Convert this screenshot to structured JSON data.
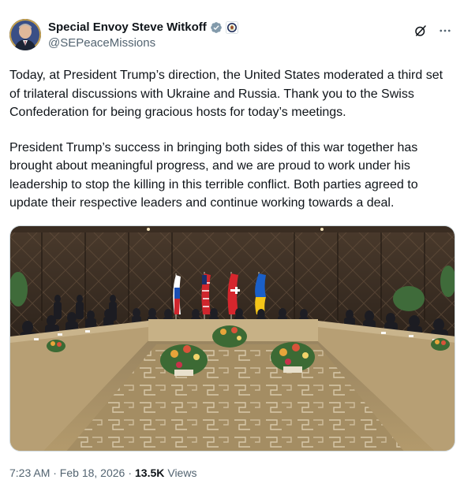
{
  "author": {
    "display_name": "Special Envoy Steve Witkoff",
    "handle": "@SEPeaceMissions",
    "verified_badge_icon": "verified-badge-icon",
    "affiliate_icon": "state-department-seal-icon"
  },
  "header_actions": {
    "grok_icon": "grok-icon",
    "more_icon": "more-icon"
  },
  "tweet": {
    "paragraphs": [
      "Today, at President Trump’s direction, the United States moderated a third set of trilateral discussions with Ukraine and Russia. Thank you to the Swiss Confederation for being gracious hosts for today’s meetings.",
      "President Trump’s success in bringing both sides of this war together has brought about meaningful progress, and we are proud to work under his leadership to stop the killing in this terrible conflict. Both parties agreed to update their respective leaders and continue working towards a deal."
    ]
  },
  "meta": {
    "timestamp": "7:23 AM · Feb 18, 2026",
    "separator": "·",
    "views_count": "13.5K",
    "views_label": "Views"
  },
  "colors": {
    "text_primary": "#0f1419",
    "text_secondary": "#536471",
    "verified_blue": "#1d9bf0",
    "border": "#cfd9de"
  }
}
